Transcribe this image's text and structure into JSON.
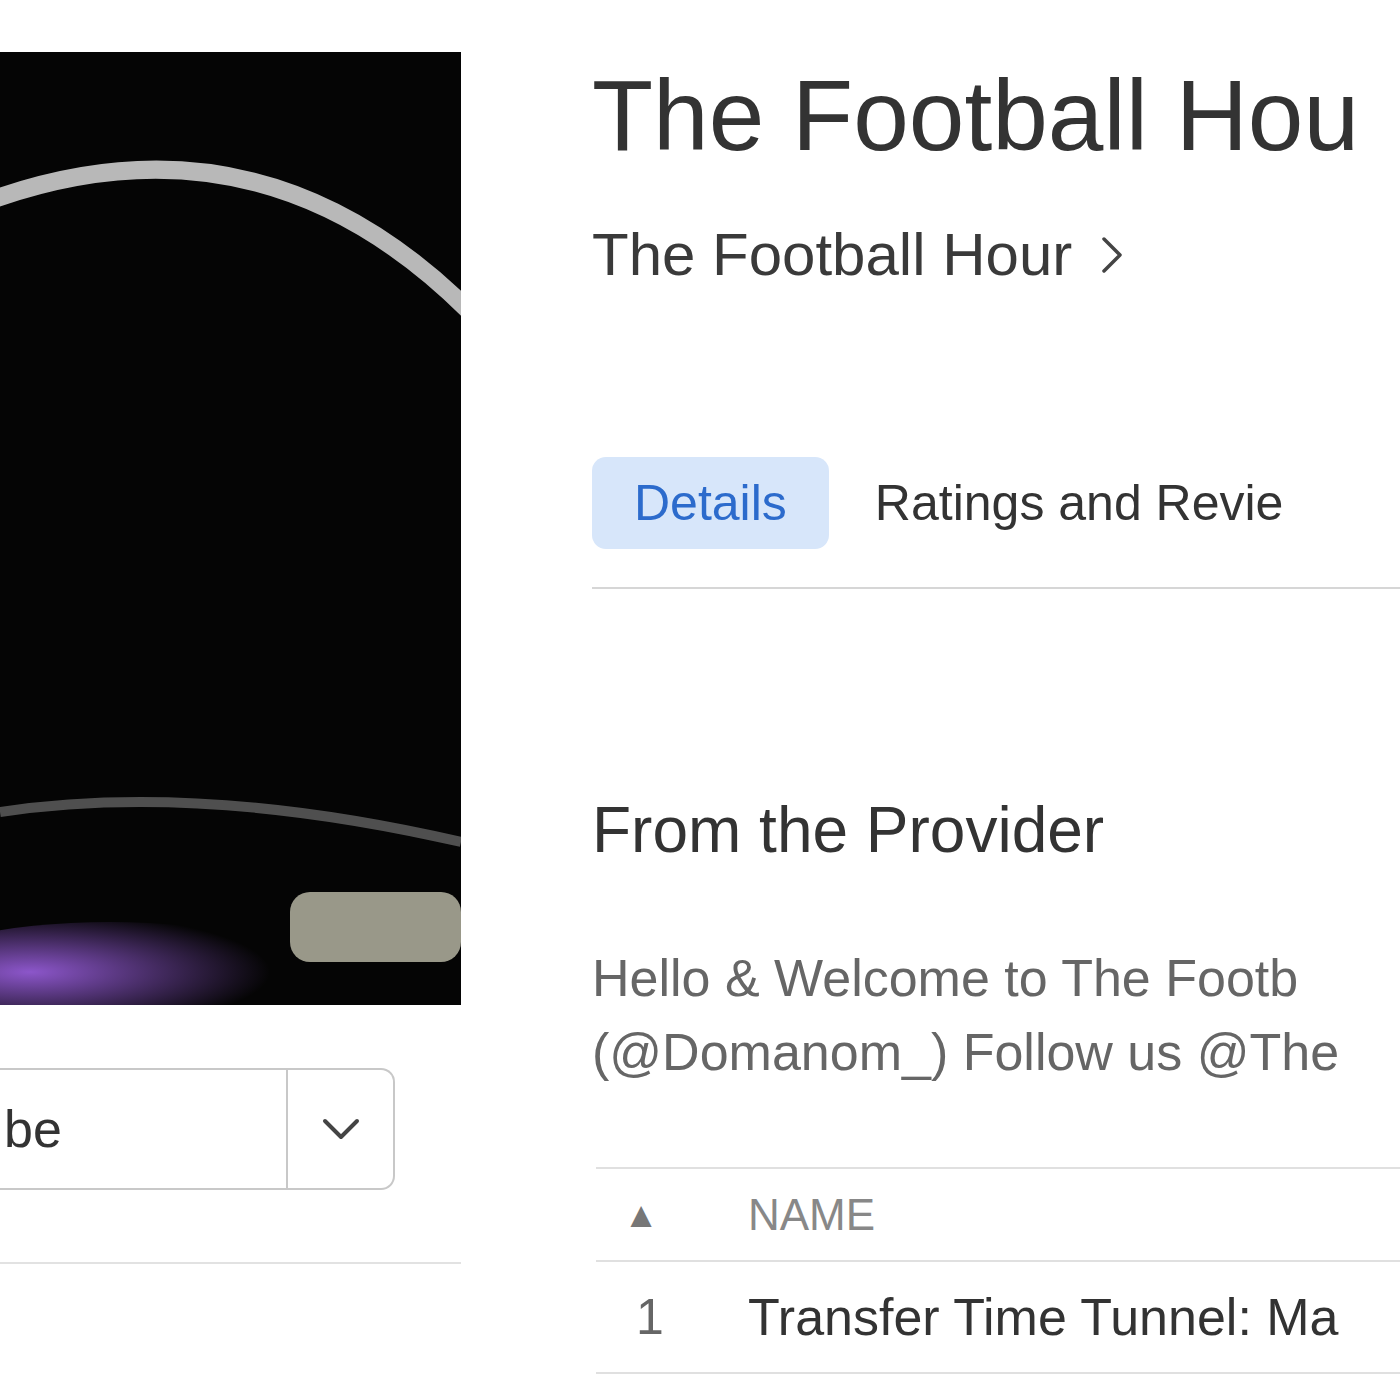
{
  "podcast": {
    "title": "The Football Hou",
    "provider": "The Football Hour"
  },
  "subscribe_button": {
    "label": "be"
  },
  "tabs": [
    {
      "label": "Details",
      "selected": true
    },
    {
      "label": "Ratings and Revie",
      "selected": false
    }
  ],
  "description": {
    "heading": "From the Provider",
    "lines": [
      "Hello & Welcome to The Footb",
      "(@Domanom_) Follow us @The"
    ]
  },
  "episodes": {
    "columns": [
      {
        "sort": "▲",
        "label": "NAME"
      }
    ],
    "rows": [
      {
        "number": "1",
        "name": "Transfer Time Tunnel: Ma"
      }
    ]
  }
}
